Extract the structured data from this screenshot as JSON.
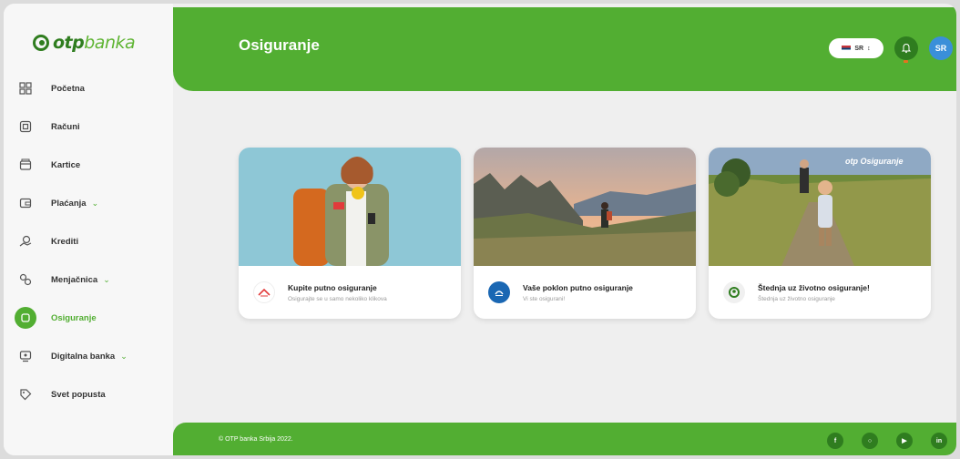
{
  "brand": {
    "logo_bold": "otp",
    "logo_light": "banka"
  },
  "sidebar": {
    "items": [
      {
        "label": "Početna",
        "icon": "dashboard-icon",
        "active": false,
        "chevron": false
      },
      {
        "label": "Računi",
        "icon": "account-icon",
        "active": false,
        "chevron": false
      },
      {
        "label": "Kartice",
        "icon": "card-icon",
        "active": false,
        "chevron": false
      },
      {
        "label": "Plaćanja",
        "icon": "payment-icon",
        "active": false,
        "chevron": true
      },
      {
        "label": "Krediti",
        "icon": "credit-icon",
        "active": false,
        "chevron": false
      },
      {
        "label": "Menjačnica",
        "icon": "exchange-icon",
        "active": false,
        "chevron": true
      },
      {
        "label": "Osiguranje",
        "icon": "insurance-icon",
        "active": true,
        "chevron": false
      },
      {
        "label": "Digitalna banka",
        "icon": "digital-bank-icon",
        "active": false,
        "chevron": true
      },
      {
        "label": "Svet popusta",
        "icon": "discount-tag-icon",
        "active": false,
        "chevron": false
      }
    ]
  },
  "header": {
    "title": "Osiguranje",
    "language": "SR",
    "avatar_initials": "SR"
  },
  "cards": [
    {
      "title": "Kupite putno osiguranje",
      "subtitle": "Osigurajte se u samo nekoliko klikova",
      "logo": "travel-insurance-logo-icon"
    },
    {
      "title": "Vaše poklon putno osiguranje",
      "subtitle": "Vi ste osigurani!",
      "logo": "gift-insurance-logo-icon"
    },
    {
      "title": "Štednja uz životno osiguranje!",
      "subtitle": "Štednja uz životno osiguranje",
      "logo": "otp-logo-icon",
      "image_watermark": "otp Osiguranje"
    }
  ],
  "footer": {
    "copyright": "© OTP banka Srbija 2022.",
    "social": [
      "facebook-icon",
      "instagram-icon",
      "youtube-icon",
      "linkedin-icon"
    ]
  },
  "colors": {
    "brand_green": "#52ae32",
    "dark_green": "#2f7d1f",
    "background": "#efefef"
  }
}
